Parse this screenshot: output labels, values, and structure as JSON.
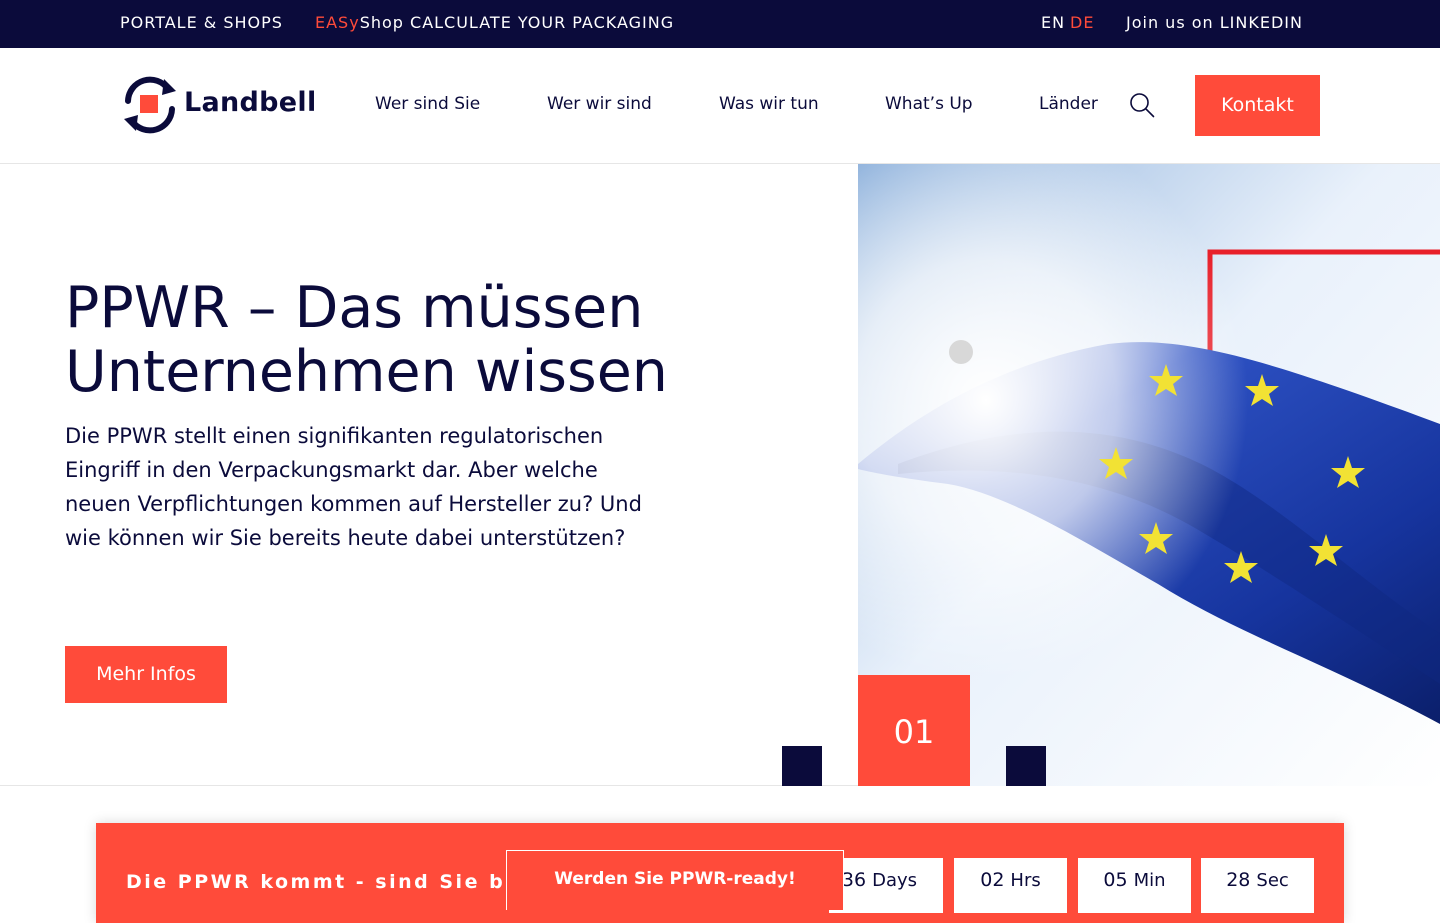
{
  "topbar": {
    "portale": "PORTALE & SHOPS",
    "easy_prefix": "EASy",
    "easy_rest": "Shop CALCULATE YOUR PACKAGING",
    "lang_en": "EN",
    "lang_de": "DE",
    "join": "Join us on  LINKEDIN"
  },
  "header": {
    "logo_text": "Landbell",
    "nav": [
      {
        "label": "Wer sind Sie"
      },
      {
        "label": "Wer wir sind"
      },
      {
        "label": "Was wir tun"
      },
      {
        "label": "What’s Up"
      },
      {
        "label": "Länder"
      }
    ],
    "chevron_glyph": "",
    "kontakt": "Kontakt"
  },
  "hero": {
    "title": "PPWR – Das müssen Unternehmen wissen",
    "text": "Die PPWR stellt einen signifikanten regulatorischen Eingriff in den Verpackungsmarkt dar. Aber welche neuen Verpflichtungen kommen auf Hersteller zu? Und wie können wir Sie bereits heute dabei unterstützen?",
    "button": "Mehr Infos",
    "slide_number": "01",
    "prev_glyph": "",
    "next_glyph": ""
  },
  "countdown": {
    "text": "Die PPWR kommt - sind Sie b",
    "cta": "Werden Sie PPWR-ready!",
    "days": {
      "value": "36",
      "unit": "Days"
    },
    "hrs": {
      "value": "02",
      "unit": "Hrs"
    },
    "min": {
      "value": "05",
      "unit": "Min"
    },
    "sec": {
      "value": "28",
      "unit": "Sec"
    }
  },
  "colors": {
    "navy": "#0b0b3b",
    "accent": "#ff4b3a"
  }
}
